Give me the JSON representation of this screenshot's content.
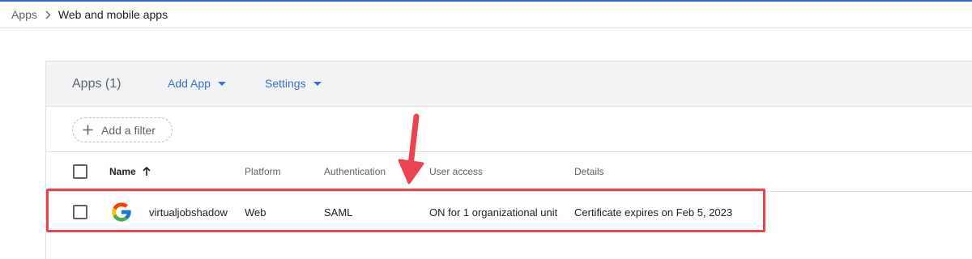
{
  "breadcrumb": {
    "parent": "Apps",
    "current": "Web and mobile apps"
  },
  "toolbar": {
    "apps_count": "Apps (1)",
    "add_app": "Add App",
    "settings": "Settings"
  },
  "filter": {
    "add_filter_label": "Add a filter"
  },
  "table": {
    "columns": [
      "Name",
      "Platform",
      "Authentication",
      "User access",
      "Details"
    ],
    "rows": [
      {
        "name": "virtualjobshadow",
        "platform": "Web",
        "authentication": "SAML",
        "user_access": "ON for 1 organizational unit",
        "details": "Certificate expires on Feb 5, 2023"
      }
    ]
  },
  "icons": {
    "breadcrumb_sep": "chevron-right-icon",
    "menu_caret": "caret-down-icon",
    "filter": "plus-icon",
    "sort": "arrow-up-icon",
    "app_logo": "google-logo-icon"
  },
  "colors": {
    "accent_blue": "#3c6fd1",
    "top_line": "#3367d6",
    "annotation_red": "#ea4450",
    "header_bg": "#f1f3f4"
  }
}
